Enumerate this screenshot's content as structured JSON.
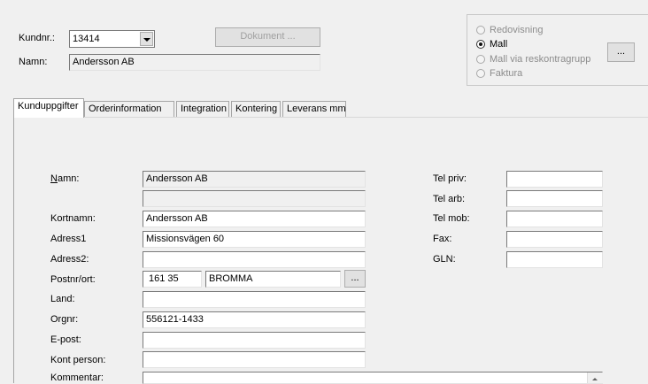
{
  "header": {
    "kundnr_label": "Kundnr.:",
    "kundnr_value": "13414",
    "namn_label": "Namn:",
    "namn_value": "Andersson AB",
    "dokument_button": "Dokument ..."
  },
  "options": {
    "items": [
      {
        "label": "Redovisning",
        "selected": false,
        "enabled": false
      },
      {
        "label": "Mall",
        "selected": true,
        "enabled": true
      },
      {
        "label": "Mall via reskontragrupp",
        "selected": false,
        "enabled": false
      },
      {
        "label": "Faktura",
        "selected": false,
        "enabled": false
      }
    ],
    "browse_button": "..."
  },
  "tabs": [
    {
      "label": "Kunduppgifter",
      "active": true
    },
    {
      "label": "Orderinformation",
      "active": false
    },
    {
      "label": "Integration",
      "active": false
    },
    {
      "label": "Kontering",
      "active": false
    },
    {
      "label": "Leverans mm",
      "active": false
    }
  ],
  "form": {
    "namn_label": "Namn:",
    "namn_value": "Andersson AB",
    "namn2_value": "",
    "kortnamn_label": "Kortnamn:",
    "kortnamn_value": "Andersson AB",
    "adress1_label": "Adress1",
    "adress1_value": "Missionsvägen 60",
    "adress2_label": "Adress2:",
    "adress2_value": "",
    "postnr_label": "Postnr/ort:",
    "postnr_value": "161 35",
    "ort_value": "BROMMA",
    "ort_button": "...",
    "land_label": "Land:",
    "land_value": "",
    "orgnr_label": "Orgnr:",
    "orgnr_value": "556121-1433",
    "epost_label": "E-post:",
    "epost_value": "",
    "kontperson_label": "Kont person:",
    "kontperson_value": "",
    "kommentar_label": "Kommentar:",
    "kommentar_value": "",
    "telpriv_label": "Tel priv:",
    "telpriv_value": "",
    "telarb_label": "Tel arb:",
    "telarb_value": "",
    "telmob_label": "Tel mob:",
    "telmob_value": "",
    "fax_label": "Fax:",
    "fax_value": "",
    "gln_label": "GLN:",
    "gln_value": ""
  }
}
